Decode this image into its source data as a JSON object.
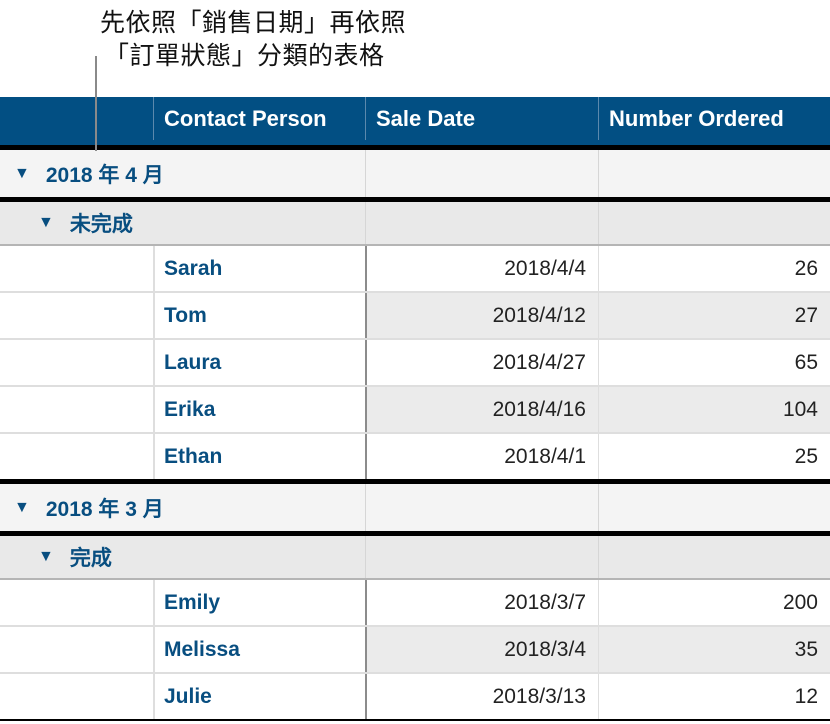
{
  "callout": {
    "line1": "先依照「銷售日期」再依照",
    "line2": "「訂單狀態」分類的表格"
  },
  "table": {
    "headers": [
      "",
      "Contact Person",
      "Sale Date",
      "Number Ordered"
    ],
    "colors": {
      "header_bg": "#024f83",
      "group_text": "#084e80"
    },
    "groups": [
      {
        "label": "2018 年 4 月",
        "subgroups": [
          {
            "label": "未完成",
            "rows": [
              {
                "contact": "Sarah",
                "date": "2018/4/4",
                "number": "26"
              },
              {
                "contact": "Tom",
                "date": "2018/4/12",
                "number": "27"
              },
              {
                "contact": "Laura",
                "date": "2018/4/27",
                "number": "65"
              },
              {
                "contact": "Erika",
                "date": "2018/4/16",
                "number": "104"
              },
              {
                "contact": "Ethan",
                "date": "2018/4/1",
                "number": "25"
              }
            ]
          }
        ]
      },
      {
        "label": "2018 年 3 月",
        "subgroups": [
          {
            "label": "完成",
            "rows": [
              {
                "contact": "Emily",
                "date": "2018/3/7",
                "number": "200"
              },
              {
                "contact": "Melissa",
                "date": "2018/3/4",
                "number": "35"
              },
              {
                "contact": "Julie",
                "date": "2018/3/13",
                "number": "12"
              }
            ]
          }
        ]
      }
    ],
    "disclosure_icon": "▼"
  }
}
